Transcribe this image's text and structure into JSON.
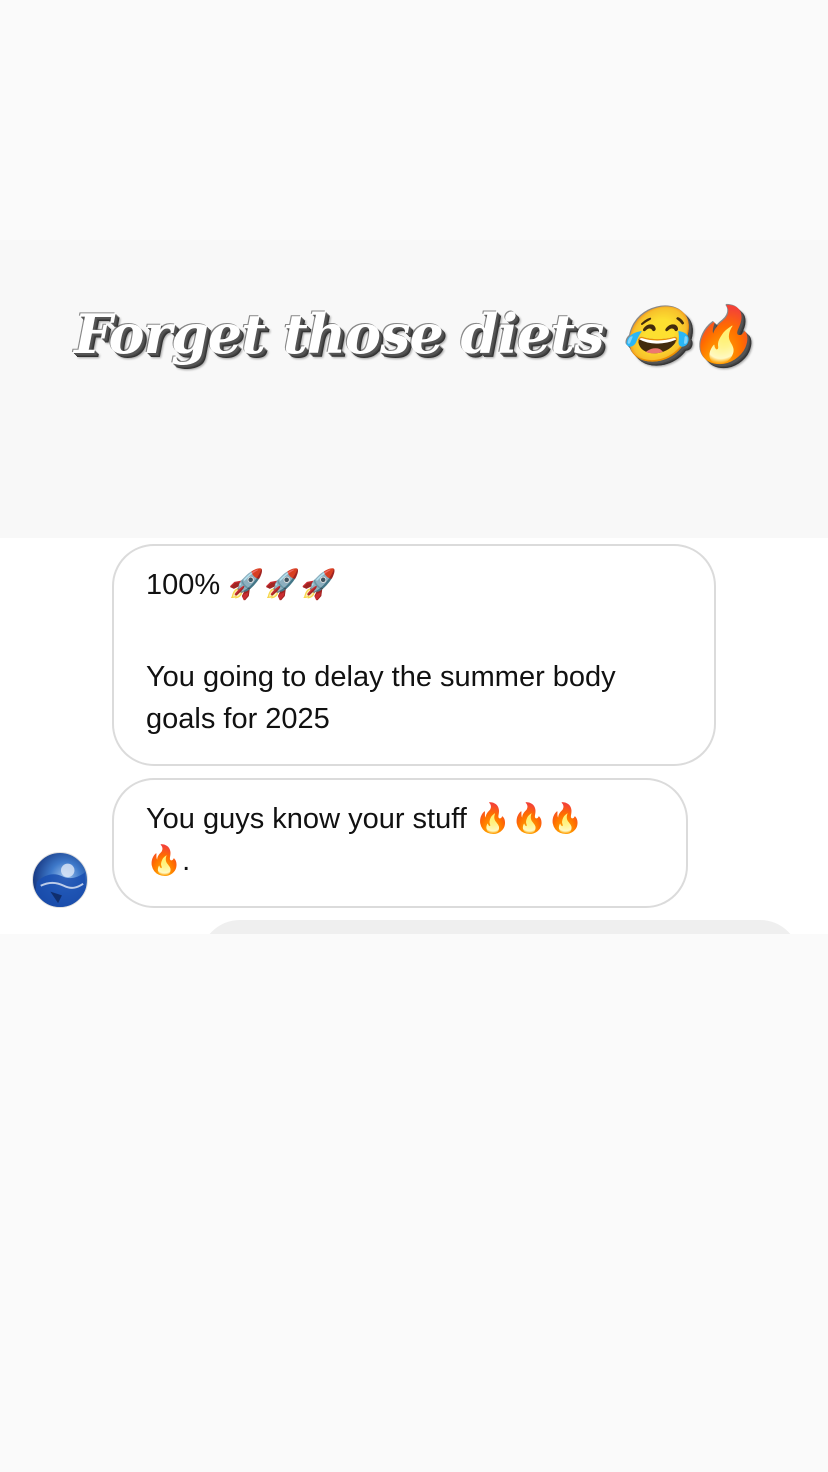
{
  "story": {
    "caption": "Forget those diets 😂🔥"
  },
  "messages": [
    {
      "lines": [
        "100% 🚀🚀🚀",
        "",
        "You going to delay the summer body",
        "goals for 2025"
      ]
    },
    {
      "lines": [
        "You guys know your stuff 🔥🔥🔥",
        "🔥."
      ]
    }
  ],
  "sender": {
    "avatar_icon": "profile-photo"
  },
  "colors": {
    "bubble_border": "#dbdbdb",
    "text": "#111111",
    "background": "#fafafa",
    "chat_background": "#ffffff",
    "next_bubble": "#efefef"
  }
}
